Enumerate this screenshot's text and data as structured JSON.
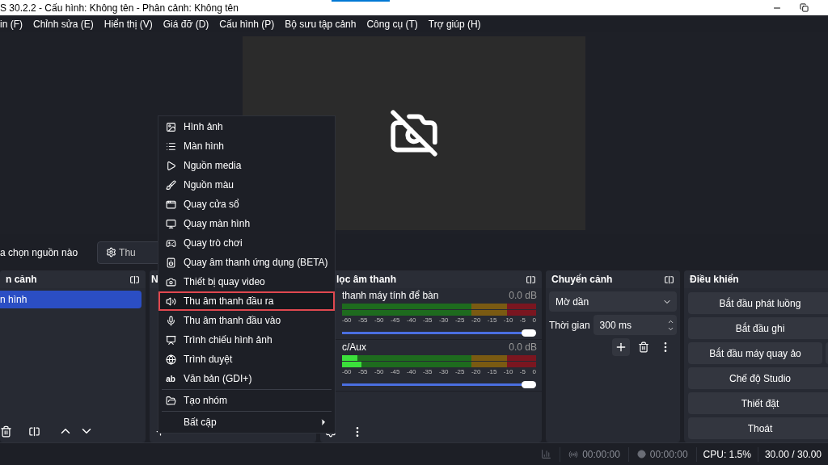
{
  "window": {
    "title": "S 30.2.2 - Cấu hình: Không tên - Phân cảnh: Không tên"
  },
  "menu_bar": [
    "in (F)",
    "Chỉnh sửa (E)",
    "Hiển thị (V)",
    "Giá đỡ (D)",
    "Cấu hình (P)",
    "Bộ sưu tập cảnh",
    "Công cụ (T)",
    "Trợ giúp (H)"
  ],
  "source_bar": {
    "status": "a chọn nguồn nào",
    "properties_button": "Thu"
  },
  "scenes": {
    "title": "n cảnh",
    "items": [
      {
        "label": "n hình",
        "selected": true
      }
    ]
  },
  "sources": {
    "title": "N"
  },
  "mixer": {
    "title": "lọc âm thanh",
    "channels": [
      {
        "name": "thanh máy tính để bàn",
        "reading": "0.0 dB",
        "scale": [
          "-60",
          "-55",
          "-50",
          "-45",
          "-40",
          "-35",
          "-30",
          "-25",
          "-20",
          "-15",
          "-10",
          "-5",
          "0"
        ],
        "level": 1
      },
      {
        "name": "c/Aux",
        "reading": "0.0 dB",
        "meters": [
          {
            "level": 0.08
          },
          {
            "level": 0.1
          }
        ],
        "scale": [
          "-60",
          "-55",
          "-50",
          "-45",
          "-40",
          "-35",
          "-30",
          "-25",
          "-20",
          "-15",
          "-10",
          "-5",
          "0"
        ],
        "level": 1
      }
    ]
  },
  "transitions": {
    "title": "Chuyển cảnh",
    "type": "Mờ dần",
    "duration_label": "Thời gian",
    "duration": "300 ms"
  },
  "controls": {
    "title": "Điều khiển",
    "buttons": [
      "Bắt đầu phát luồng",
      "Bắt đầu ghi",
      "Bắt đầu máy quay ảo",
      "Chế độ Studio",
      "Thiết đặt",
      "Thoát"
    ]
  },
  "status_bar": {
    "stream_time": "00:00:00",
    "record_time": "00:00:00",
    "cpu": "CPU: 1.5%",
    "fps": "30.00 / 30.00"
  },
  "context_menu": [
    {
      "label": "Hình ảnh",
      "selected": false
    },
    {
      "label": "Màn hình",
      "selected": false
    },
    {
      "label": "Nguồn media",
      "selected": false
    },
    {
      "label": "Nguồn màu",
      "selected": false
    },
    {
      "label": "Quay cửa sổ",
      "selected": false
    },
    {
      "label": "Quay màn hình",
      "selected": false
    },
    {
      "label": "Quay trò chơi",
      "selected": false
    },
    {
      "label": "Quay âm thanh ứng dụng (BETA)",
      "selected": false
    },
    {
      "label": "Thiết bị quay video",
      "selected": false
    },
    {
      "label": "Thu âm thanh đầu ra",
      "selected": true
    },
    {
      "label": "Thu âm thanh đầu vào",
      "selected": false
    },
    {
      "label": "Trình chiếu hình ảnh",
      "selected": false
    },
    {
      "label": "Trình duyệt",
      "selected": false
    },
    {
      "label": "Văn bản (GDI+)",
      "selected": false,
      "glyph": "ab"
    },
    {
      "label": "Tạo nhóm",
      "selected": false,
      "separator_before": true
    },
    {
      "label": "Bất cập",
      "selected": false,
      "separator_before": true,
      "submenu": true
    }
  ]
}
